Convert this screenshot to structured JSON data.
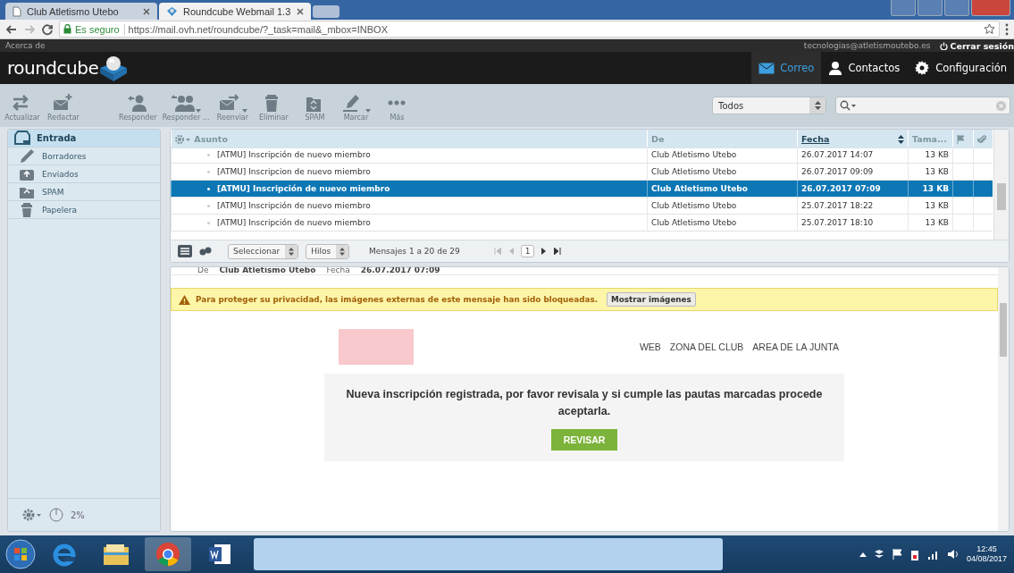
{
  "browser": {
    "tabs": [
      {
        "title": "Club Atletismo Utebo",
        "selected": false
      },
      {
        "title": "Roundcube Webmail 1.3",
        "selected": true
      }
    ],
    "secure_label": "Es seguro",
    "url": "https://mail.ovh.net/roundcube/?_task=mail&_mbox=INBOX"
  },
  "top_bar": {
    "about": "Acerca de",
    "user": "tecnologias@atletismoutebo.es",
    "logout": "Cerrar sesión"
  },
  "header": {
    "logo": "roundcube",
    "nav": [
      {
        "label": "Correo",
        "selected": true
      },
      {
        "label": "Contactos",
        "selected": false
      },
      {
        "label": "Configuración",
        "selected": false
      }
    ]
  },
  "toolbar": {
    "buttons": [
      {
        "label": "Actualizar",
        "menu": false
      },
      {
        "label": "Redactar",
        "menu": false
      },
      {
        "label": "Responder",
        "menu": false
      },
      {
        "label": "Responder ...",
        "menu": true
      },
      {
        "label": "Reenviar",
        "menu": true
      },
      {
        "label": "Eliminar",
        "menu": false
      },
      {
        "label": "SPAM",
        "menu": false
      },
      {
        "label": "Marcar",
        "menu": true
      },
      {
        "label": "Más",
        "menu": false
      }
    ],
    "filter": "Todos"
  },
  "folders": [
    {
      "name": "Entrada",
      "selected": true
    },
    {
      "name": "Borradores",
      "selected": false
    },
    {
      "name": "Enviados",
      "selected": false
    },
    {
      "name": "SPAM",
      "selected": false
    },
    {
      "name": "Papelera",
      "selected": false
    }
  ],
  "quota": "2%",
  "message_list": {
    "columns": [
      {
        "label": "Asunto",
        "sorted": false
      },
      {
        "label": "De",
        "sorted": false
      },
      {
        "label": "Fecha",
        "sorted": true
      },
      {
        "label": "Tama...",
        "sorted": false
      }
    ],
    "rows": [
      {
        "subject": "[ATMU] Inscripción de nuevo miembro",
        "from": "Club Atletismo Utebo",
        "date": "26.07.2017 14:07",
        "size": "13 KB",
        "selected": false
      },
      {
        "subject": "[ATMU] Inscripcion de nuevo miembro",
        "from": "Club Atletismo Utebo",
        "date": "26.07.2017 09:09",
        "size": "13 KB",
        "selected": false
      },
      {
        "subject": "[ATMU] Inscripción de nuevo miembro",
        "from": "Club Atletismo Utebo",
        "date": "26.07.2017 07:09",
        "size": "13 KB",
        "selected": true
      },
      {
        "subject": "[ATMU] Inscripción de nuevo miembro",
        "from": "Club Atletismo Utebo",
        "date": "25.07.2017 18:22",
        "size": "13 KB",
        "selected": false
      },
      {
        "subject": "[ATMU] Inscripción de nuevo miembro",
        "from": "Club Atletismo Utebo",
        "date": "25.07.2017 18:10",
        "size": "13 KB",
        "selected": false
      }
    ],
    "select": "Seleccionar",
    "threads": "Hilos",
    "count": "Mensajes 1 a 20 de 29",
    "page": "1"
  },
  "preview": {
    "from_label": "De",
    "from": "Club Atletismo Utebo",
    "date_label": "Fecha",
    "date": "26.07.2017 07:09",
    "warning": "Para proteger su privacidad, las imágenes externas de este mensaje han sido bloqueadas.",
    "show_images": "Mostrar imágenes",
    "email": {
      "links": [
        "WEB",
        "ZONA DEL CLUB",
        "AREA DE LA JUNTA"
      ],
      "message": "Nueva inscripción registrada, por favor revisala y si cumple las pautas marcadas procede aceptarla.",
      "button": "REVISAR"
    }
  },
  "taskbar": {
    "time": "12:45",
    "date": "04/08/2017"
  }
}
